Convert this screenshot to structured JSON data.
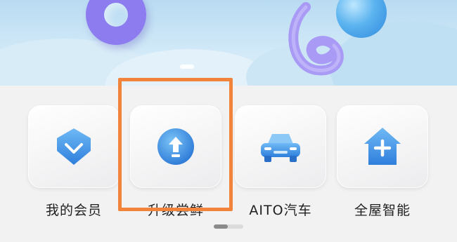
{
  "shortcuts": [
    {
      "label": "我的会员",
      "icon": "membership-badge-icon"
    },
    {
      "label": "升级尝鲜",
      "icon": "upgrade-arrow-icon"
    },
    {
      "label": "AITO汽车",
      "icon": "car-icon"
    },
    {
      "label": "全屋智能",
      "icon": "smart-home-icon"
    }
  ],
  "banner": {
    "carousel_index": 1
  },
  "colors": {
    "highlight": "#f2833a",
    "icon_blue": "#3a8fe3",
    "tile_bg": "#f0f0f2"
  }
}
